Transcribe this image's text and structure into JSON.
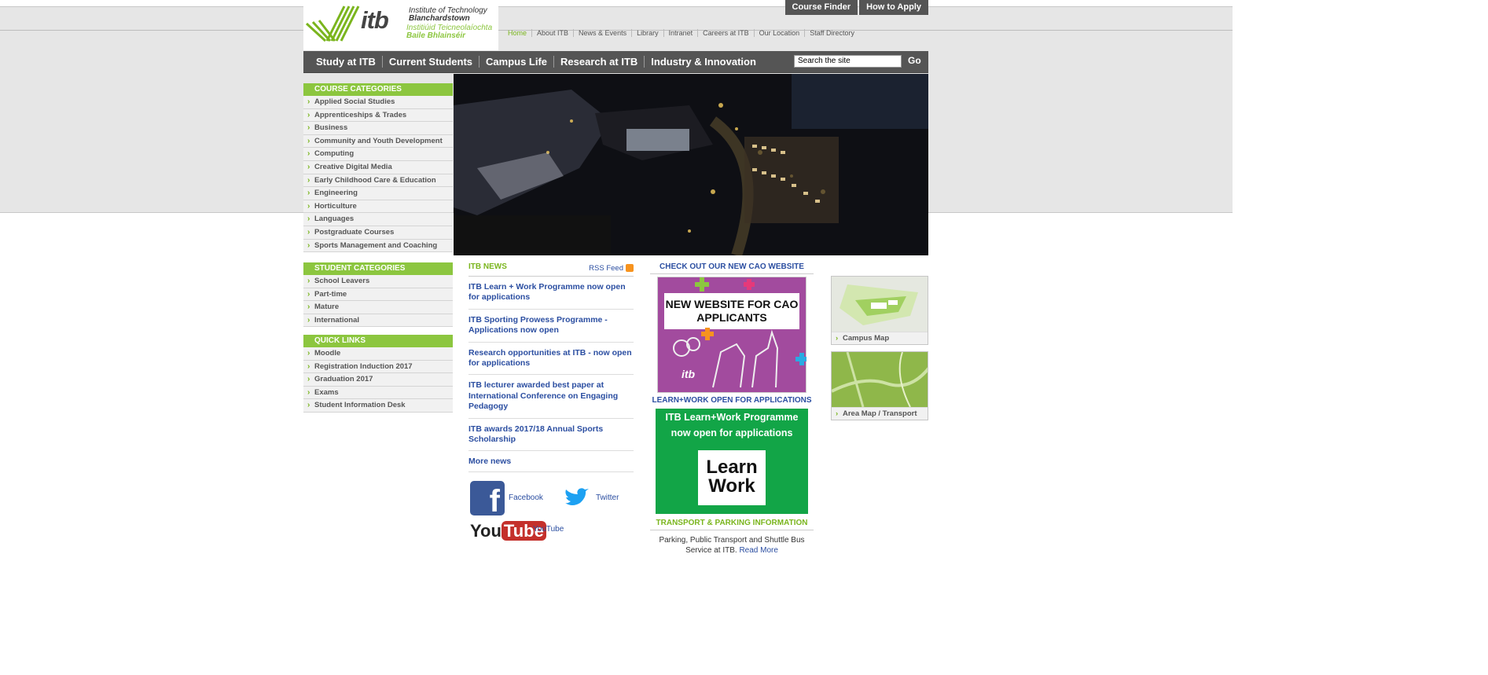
{
  "logo": {
    "mark": "itb",
    "line1": "Institute of Technology",
    "line2": "Blanchardstown",
    "line3": "Institiúid Teicneolaíochta",
    "line4": "Baile Bhlainséir"
  },
  "top_buttons": [
    "Course Finder",
    "How to Apply"
  ],
  "util_nav": [
    "Home",
    "About ITB",
    "News & Events",
    "Library",
    "Intranet",
    "Careers at ITB",
    "Our Location",
    "Staff Directory"
  ],
  "main_nav": [
    "Study at ITB",
    "Current Students",
    "Campus Life",
    "Research at ITB",
    "Industry & Innovation"
  ],
  "search": {
    "value": "Search the site",
    "button": "Go"
  },
  "course_categories": {
    "title": "COURSE CATEGORIES",
    "items": [
      "Applied Social Studies",
      "Apprenticeships & Trades",
      "Business",
      "Community and Youth Development",
      "Computing",
      "Creative Digital Media",
      "Early Childhood Care & Education",
      "Engineering",
      "Horticulture",
      "Languages",
      "Postgraduate Courses",
      "Sports Management and Coaching"
    ]
  },
  "student_categories": {
    "title": "STUDENT CATEGORIES",
    "items": [
      "School Leavers",
      "Part-time",
      "Mature",
      "International"
    ]
  },
  "quick_links": {
    "title": "QUICK LINKS",
    "items": [
      "Moodle",
      "Registration Induction 2017",
      "Graduation 2017",
      "Exams",
      "Student Information Desk"
    ]
  },
  "news": {
    "title": "ITB NEWS",
    "rss": "RSS Feed",
    "items": [
      "ITB Learn + Work Programme now open for applications",
      "ITB Sporting Prowess Programme - Applications now open",
      "Research opportunities at ITB - now open for applications",
      "ITB lecturer awarded best paper at International Conference on Engaging Pedagogy",
      "ITB awards 2017/18 Annual Sports Scholarship"
    ],
    "more": "More news"
  },
  "social": {
    "facebook": "Facebook",
    "twitter": "Twitter",
    "youtube": "YouTube",
    "youtube_logo_you": "You",
    "youtube_logo_tube": "Tube"
  },
  "cao": {
    "heading": "CHECK OUT OUR NEW CAO WEBSITE",
    "banner": "NEW WEBSITE FOR CAO APPLICANTS"
  },
  "learnwork": {
    "heading": "LEARN+WORK OPEN FOR APPLICATIONS",
    "banner": "ITB Learn+Work Programme now open for applications",
    "card_line1": "Learn",
    "card_line2": "Work"
  },
  "transport": {
    "heading": "TRANSPORT & PARKING INFORMATION",
    "text": "Parking, Public Transport and Shuttle Bus Service at ITB.",
    "link": "Read More"
  },
  "thumbs": [
    "Campus Map",
    "Area Map / Transport"
  ],
  "colors": {
    "green": "#8cc63f",
    "nav": "#555555",
    "link": "#2b4ea1"
  }
}
